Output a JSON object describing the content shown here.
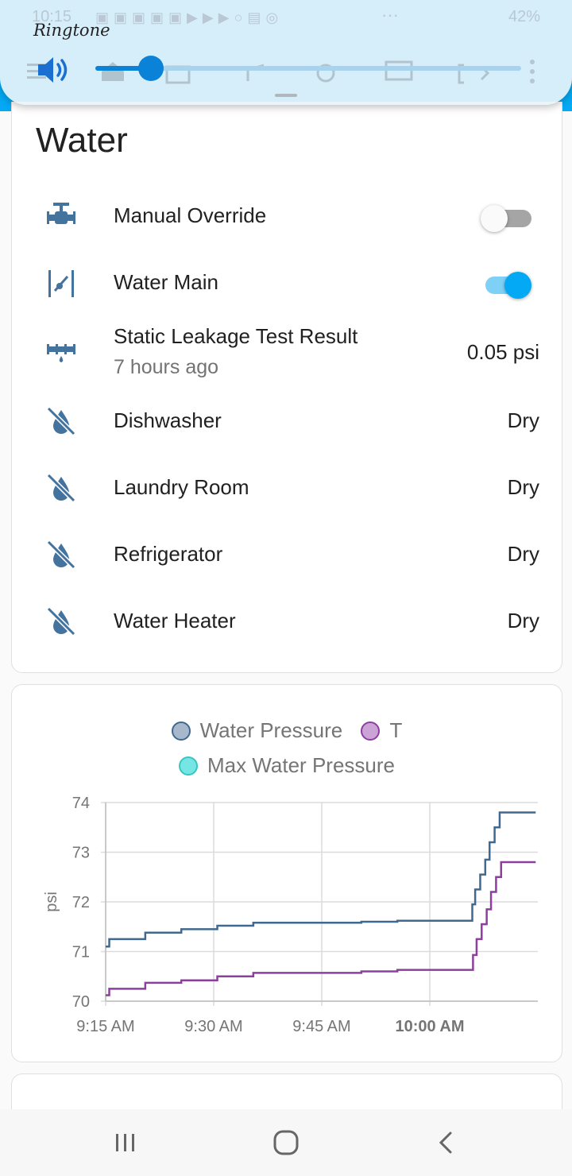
{
  "volume_panel": {
    "status_bar": {
      "time": "10:15",
      "battery": "42%"
    },
    "stream_label": "Ringtone",
    "level_fraction": 0.13,
    "speaker_icon": "volume-up-icon",
    "more_icon": "more-vertical-icon"
  },
  "water_card": {
    "title": "Water",
    "rows": [
      {
        "icon": "valve-icon",
        "label": "Manual Override",
        "type": "toggle",
        "state": "off"
      },
      {
        "icon": "valve-open-icon",
        "label": "Water Main",
        "type": "toggle",
        "state": "on"
      },
      {
        "icon": "pipe-leak-icon",
        "label": "Static Leakage Test Result",
        "secondary": "7 hours ago",
        "value": "0.05 psi"
      },
      {
        "icon": "water-off-icon",
        "label": "Dishwasher",
        "value": "Dry"
      },
      {
        "icon": "water-off-icon",
        "label": "Laundry Room",
        "value": "Dry"
      },
      {
        "icon": "water-off-icon",
        "label": "Refrigerator",
        "value": "Dry"
      },
      {
        "icon": "water-off-icon",
        "label": "Water Heater",
        "value": "Dry"
      }
    ]
  },
  "chart_data": {
    "type": "line",
    "ylabel": "psi",
    "ylim": [
      70,
      74
    ],
    "yticks": [
      "70",
      "71",
      "72",
      "73",
      "74"
    ],
    "xticks": [
      "9:15 AM",
      "9:30 AM",
      "9:45 AM",
      "10:00 AM"
    ],
    "xlim_minutes": [
      0,
      60
    ],
    "grid": true,
    "legend_position": "top",
    "series": [
      {
        "name": "Water Pressure",
        "color": "#41698f",
        "swatch_fill": "#a7b8cd",
        "points": [
          [
            0,
            71.1
          ],
          [
            0.5,
            71.25
          ],
          [
            5.5,
            71.38
          ],
          [
            10.5,
            71.45
          ],
          [
            15.5,
            71.52
          ],
          [
            20.5,
            71.58
          ],
          [
            35.5,
            71.6
          ],
          [
            40.5,
            71.62
          ],
          [
            50.9,
            71.95
          ],
          [
            51.3,
            72.25
          ],
          [
            52.0,
            72.55
          ],
          [
            52.7,
            72.85
          ],
          [
            53.3,
            73.2
          ],
          [
            54.0,
            73.5
          ],
          [
            54.7,
            73.8
          ],
          [
            59.7,
            73.8
          ]
        ]
      },
      {
        "name": "T",
        "color": "#8d3e9f",
        "swatch_fill": "#cba3d7",
        "points": [
          [
            0,
            70.12
          ],
          [
            0.5,
            70.25
          ],
          [
            5.5,
            70.37
          ],
          [
            10.5,
            70.42
          ],
          [
            15.5,
            70.5
          ],
          [
            20.5,
            70.57
          ],
          [
            35.5,
            70.6
          ],
          [
            40.5,
            70.63
          ],
          [
            51.0,
            70.93
          ],
          [
            51.5,
            71.25
          ],
          [
            52.2,
            71.55
          ],
          [
            52.9,
            71.85
          ],
          [
            53.5,
            72.2
          ],
          [
            54.2,
            72.5
          ],
          [
            54.9,
            72.8
          ],
          [
            59.7,
            72.8
          ]
        ]
      },
      {
        "name": "Max Water Pressure",
        "color": "#39c6c0",
        "swatch_fill": "#76e6e4",
        "points": []
      }
    ]
  },
  "navbar": {
    "recents_icon": "recent-apps-icon",
    "home_icon": "home-circle-icon",
    "back_icon": "back-chevron-icon"
  }
}
